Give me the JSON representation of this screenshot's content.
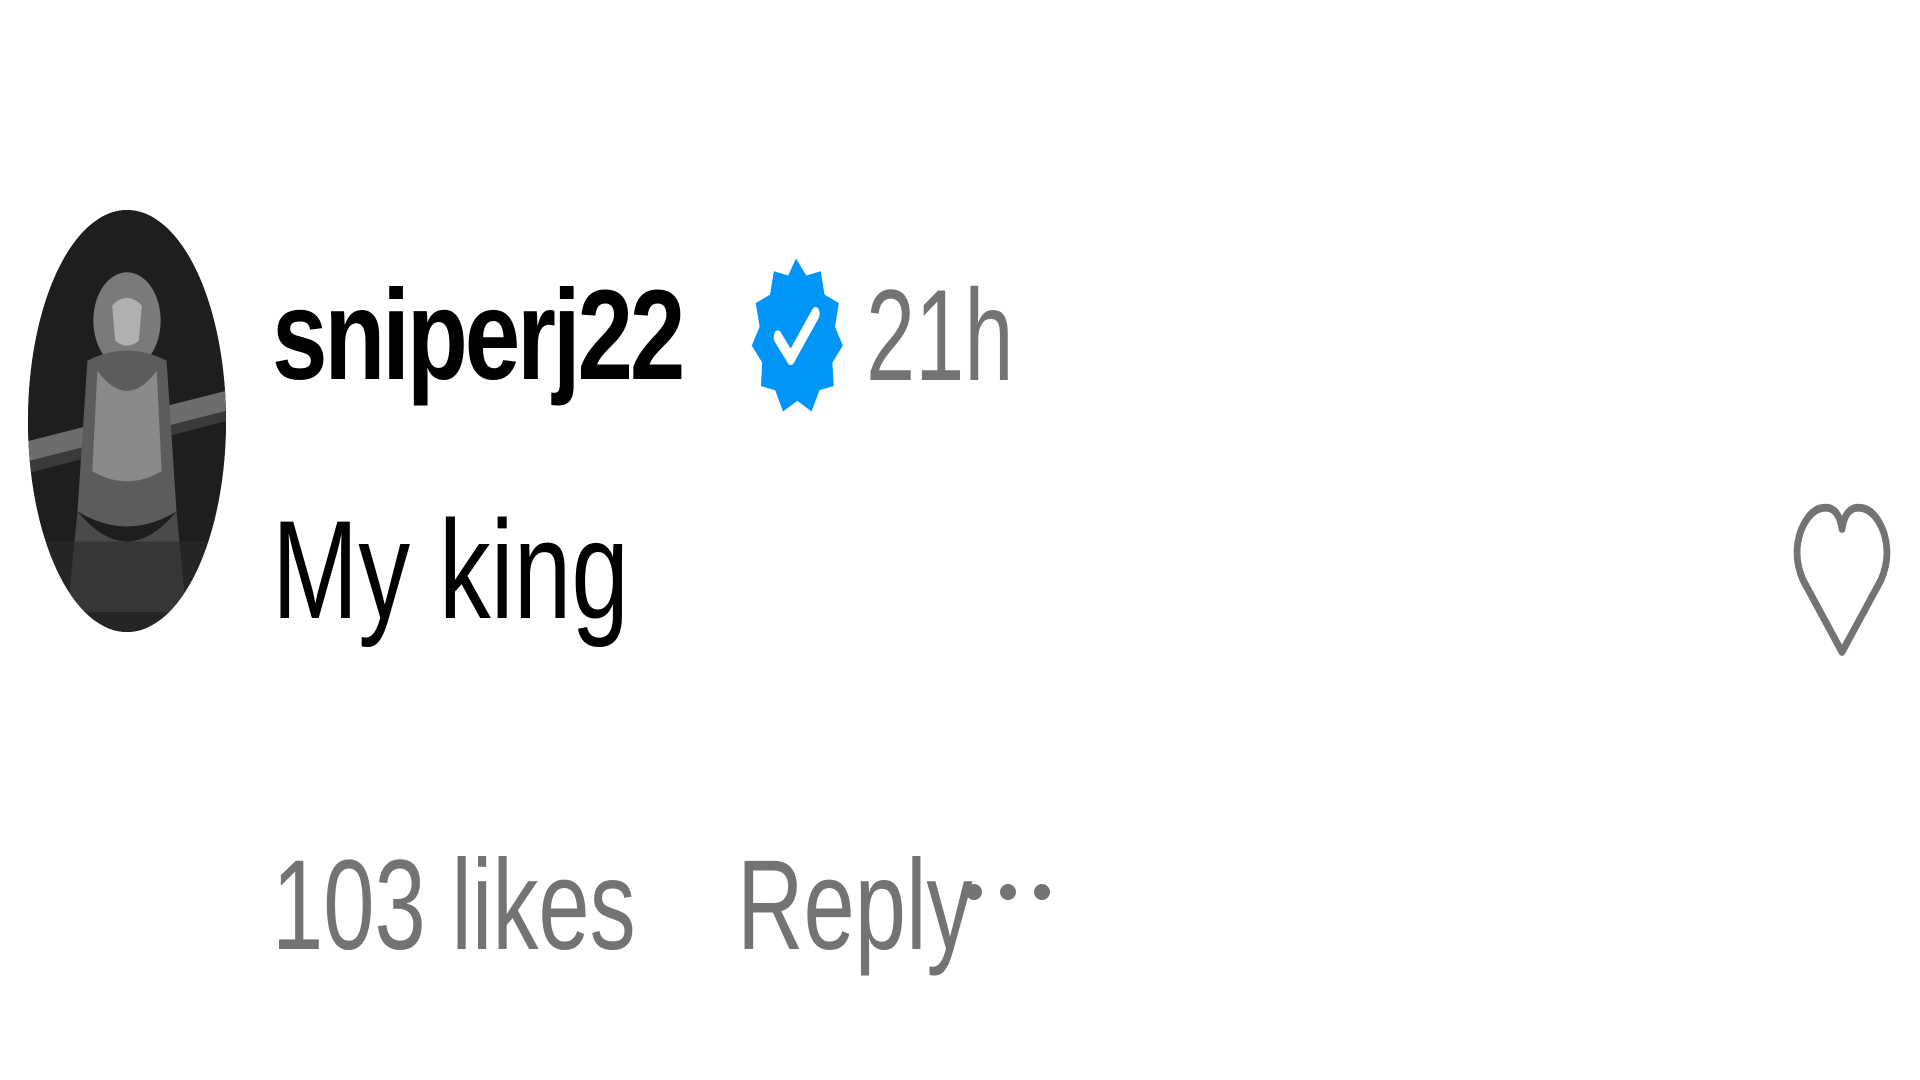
{
  "comment": {
    "username": "sniperj22",
    "verified_icon": "verified-badge-icon",
    "timestamp": "21h",
    "text": "My king",
    "likes_label": "103 likes",
    "reply_label": "Reply",
    "more_icon": "more-options-icon",
    "like_icon": "heart-outline-icon",
    "avatar_description_icon": "avatar"
  },
  "colors": {
    "text_primary": "#000000",
    "text_secondary": "#737373",
    "verified_blue": "#0095f6",
    "icon_gray": "#737373"
  }
}
